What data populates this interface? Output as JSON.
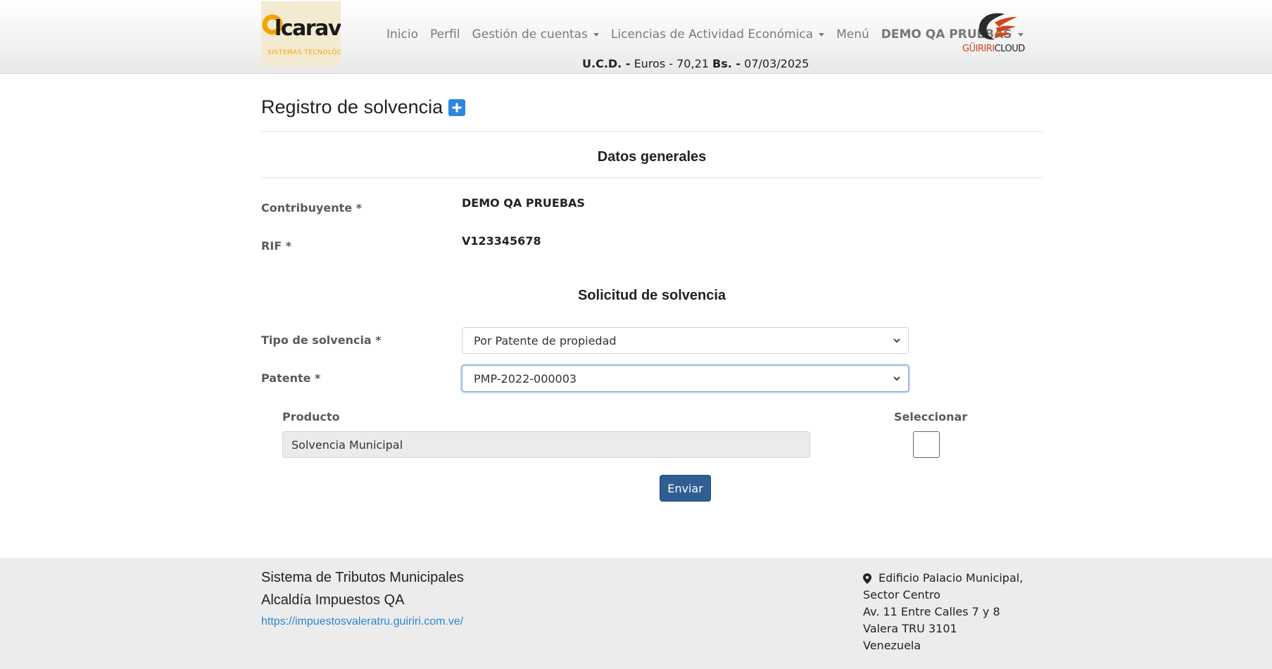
{
  "header": {
    "nav": [
      {
        "label": "Inicio",
        "dropdown": false
      },
      {
        "label": "Perfil",
        "dropdown": false
      },
      {
        "label": "Gestión de cuentas",
        "dropdown": true
      },
      {
        "label": "Licencias de Actividad Económica",
        "dropdown": true
      },
      {
        "label": "Menú",
        "dropdown": false
      },
      {
        "label": "DEMO QA PRUEBAS",
        "dropdown": true
      }
    ],
    "rate": {
      "ucd_label": "U.C.D. -",
      "currency": "Euros -",
      "amount": "70,21",
      "bs_label": "Bs. -",
      "date": "07/03/2025"
    },
    "cloud_logo": {
      "part1": "GÜIRIRI",
      "part2": "CLOUD"
    }
  },
  "main": {
    "title": "Registro de solvencia",
    "general_section": "Datos generales",
    "fields": {
      "contribuyente_label": "Contribuyente *",
      "contribuyente_value": "DEMO QA PRUEBAS",
      "rif_label": "RIF *",
      "rif_value": "V123345678"
    },
    "request_section": "Solicitud de solvencia",
    "tipo_label": "Tipo de solvencia *",
    "tipo_value": "Por Patente de propiedad",
    "patente_label": "Patente *",
    "patente_value": "PMP-2022-000003",
    "product_header": "Producto",
    "select_header": "Seleccionar",
    "product_value": "Solvencia Municipal",
    "submit": "Enviar"
  },
  "footer": {
    "system": "Sistema de Tributos Municipales",
    "office": "Alcaldía Impuestos QA",
    "url": "https://impuestosvaleratru.guiriri.com.ve/",
    "address": [
      "Edificio Palacio Municipal,",
      "Sector Centro",
      "Av. 11 Entre Calles 7 y 8",
      "Valera TRU 3101",
      "Venezuela"
    ]
  },
  "icons": {
    "add": "plus-square-icon",
    "location": "map-pin-icon"
  },
  "colors": {
    "accent": "#2e86de",
    "button": "#2f5e92",
    "link": "#2a86d1",
    "logo_orange": "#f2a400",
    "cloud_red": "#d2461c"
  }
}
